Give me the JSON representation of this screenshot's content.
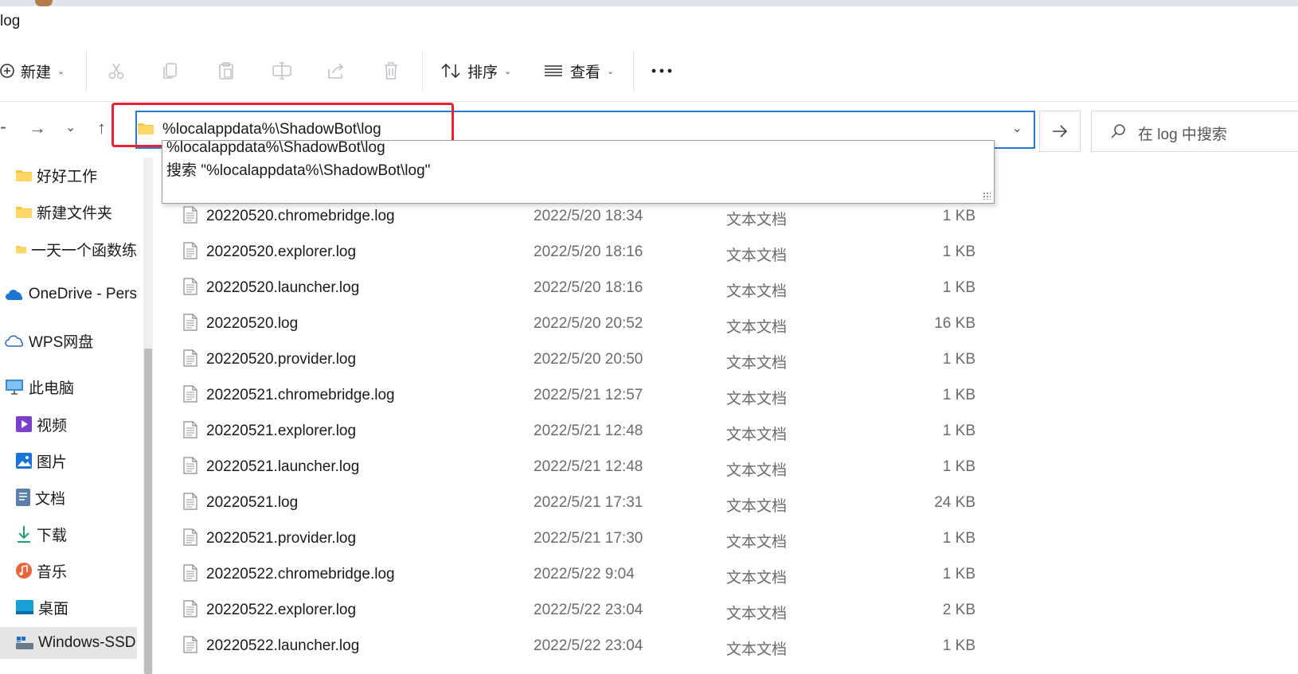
{
  "window": {
    "title": "log"
  },
  "toolbar": {
    "new_label": "新建",
    "sort_label": "排序",
    "view_label": "查看",
    "more_label": "..."
  },
  "address": {
    "path": "%localappdata%\\ShadowBot\\log",
    "search_placeholder": "在 log 中搜索",
    "suggestions": [
      "%localappdata%\\ShadowBot\\log",
      "搜索 \"%localappdata%\\ShadowBot\\log\""
    ]
  },
  "sidebar": {
    "items": [
      {
        "label": "好好工作",
        "icon": "folder-icon"
      },
      {
        "label": "新建文件夹",
        "icon": "folder-icon"
      },
      {
        "label": "一天一个函数练",
        "icon": "folder-icon"
      },
      {
        "label": "OneDrive - Pers",
        "icon": "onedrive-icon"
      },
      {
        "label": "WPS网盘",
        "icon": "cloud-icon"
      },
      {
        "label": "此电脑",
        "icon": "computer-icon"
      },
      {
        "label": "视频",
        "icon": "video-icon"
      },
      {
        "label": "图片",
        "icon": "picture-icon"
      },
      {
        "label": "文档",
        "icon": "document-icon"
      },
      {
        "label": "下载",
        "icon": "download-icon"
      },
      {
        "label": "音乐",
        "icon": "music-icon"
      },
      {
        "label": "桌面",
        "icon": "desktop-icon"
      },
      {
        "label": "Windows-SSD",
        "icon": "drive-icon"
      }
    ]
  },
  "files": [
    {
      "name": "20220520.chromebridge.log",
      "date": "2022/5/20 18:34",
      "type": "文本文档",
      "size": "1 KB"
    },
    {
      "name": "20220520.explorer.log",
      "date": "2022/5/20 18:16",
      "type": "文本文档",
      "size": "1 KB"
    },
    {
      "name": "20220520.launcher.log",
      "date": "2022/5/20 18:16",
      "type": "文本文档",
      "size": "1 KB"
    },
    {
      "name": "20220520.log",
      "date": "2022/5/20 20:52",
      "type": "文本文档",
      "size": "16 KB"
    },
    {
      "name": "20220520.provider.log",
      "date": "2022/5/20 20:50",
      "type": "文本文档",
      "size": "1 KB"
    },
    {
      "name": "20220521.chromebridge.log",
      "date": "2022/5/21 12:57",
      "type": "文本文档",
      "size": "1 KB"
    },
    {
      "name": "20220521.explorer.log",
      "date": "2022/5/21 12:48",
      "type": "文本文档",
      "size": "1 KB"
    },
    {
      "name": "20220521.launcher.log",
      "date": "2022/5/21 12:48",
      "type": "文本文档",
      "size": "1 KB"
    },
    {
      "name": "20220521.log",
      "date": "2022/5/21 17:31",
      "type": "文本文档",
      "size": "24 KB"
    },
    {
      "name": "20220521.provider.log",
      "date": "2022/5/21 17:30",
      "type": "文本文档",
      "size": "1 KB"
    },
    {
      "name": "20220522.chromebridge.log",
      "date": "2022/5/22 9:04",
      "type": "文本文档",
      "size": "1 KB"
    },
    {
      "name": "20220522.explorer.log",
      "date": "2022/5/22 23:04",
      "type": "文本文档",
      "size": "2 KB"
    },
    {
      "name": "20220522.launcher.log",
      "date": "2022/5/22 23:04",
      "type": "文本文档",
      "size": "1 KB"
    }
  ],
  "colors": {
    "accent": "#2a7ad4",
    "highlight_box": "#e8232f",
    "folder": "#f6c443",
    "selected_bg": "#e5e5e5"
  }
}
